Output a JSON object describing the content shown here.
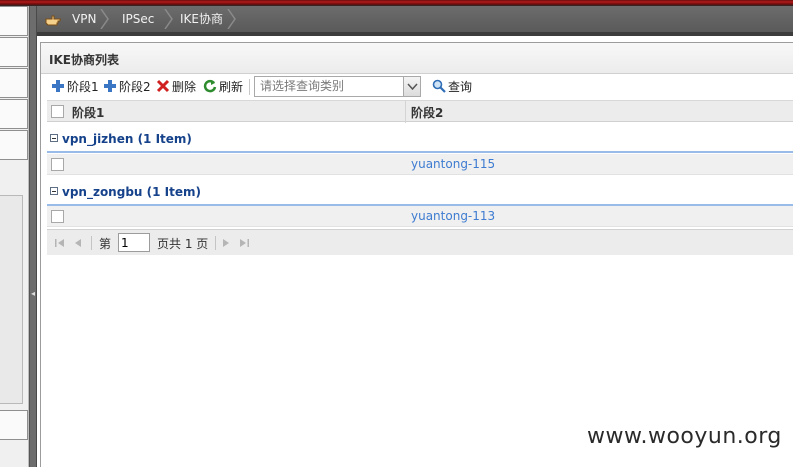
{
  "breadcrumb": {
    "items": [
      "VPN",
      "IPSec",
      "IKE协商"
    ]
  },
  "panel": {
    "title": "IKE协商列表"
  },
  "toolbar": {
    "add_phase1": "阶段1",
    "add_phase2": "阶段2",
    "delete": "删除",
    "refresh": "刷新",
    "query_type_placeholder": "请选择查询类别",
    "query": "查询"
  },
  "grid": {
    "columns": [
      "阶段1",
      "阶段2"
    ],
    "groups": [
      {
        "label": "vpn_jizhen (1 Item)",
        "rows": [
          {
            "phase1": "",
            "phase2": "yuantong-115"
          }
        ]
      },
      {
        "label": "vpn_zongbu (1 Item)",
        "rows": [
          {
            "phase1": "",
            "phase2": "yuantong-113"
          }
        ]
      }
    ]
  },
  "pager": {
    "page_prefix": "第",
    "page_value": "1",
    "page_suffix": "页共 1 页"
  },
  "watermark": "www.wooyun.org",
  "colors": {
    "group_text": "#15428b",
    "link": "#3e7cd1",
    "breadcrumb_bg": "#5f5f5f",
    "top_strip": "#b21a1a"
  }
}
